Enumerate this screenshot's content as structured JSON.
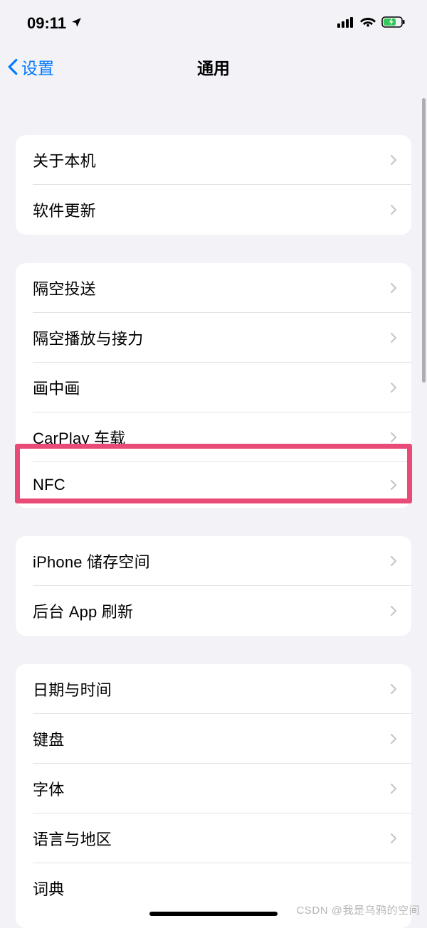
{
  "statusBar": {
    "time": "09:11"
  },
  "nav": {
    "back": "设置",
    "title": "通用"
  },
  "groups": [
    {
      "items": [
        {
          "label": "关于本机",
          "name": "about"
        },
        {
          "label": "软件更新",
          "name": "software-update"
        }
      ]
    },
    {
      "items": [
        {
          "label": "隔空投送",
          "name": "airdrop"
        },
        {
          "label": "隔空播放与接力",
          "name": "airplay-handoff"
        },
        {
          "label": "画中画",
          "name": "picture-in-picture"
        },
        {
          "label": "CarPlay 车载",
          "name": "carplay"
        },
        {
          "label": "NFC",
          "name": "nfc"
        }
      ]
    },
    {
      "items": [
        {
          "label": "iPhone 储存空间",
          "name": "iphone-storage"
        },
        {
          "label": "后台 App 刷新",
          "name": "background-app-refresh"
        }
      ]
    },
    {
      "items": [
        {
          "label": "日期与时间",
          "name": "date-time"
        },
        {
          "label": "键盘",
          "name": "keyboard"
        },
        {
          "label": "字体",
          "name": "fonts"
        },
        {
          "label": "语言与地区",
          "name": "language-region"
        },
        {
          "label": "词典",
          "name": "dictionary"
        }
      ]
    }
  ],
  "watermark": "CSDN @我是乌鸦的空间"
}
